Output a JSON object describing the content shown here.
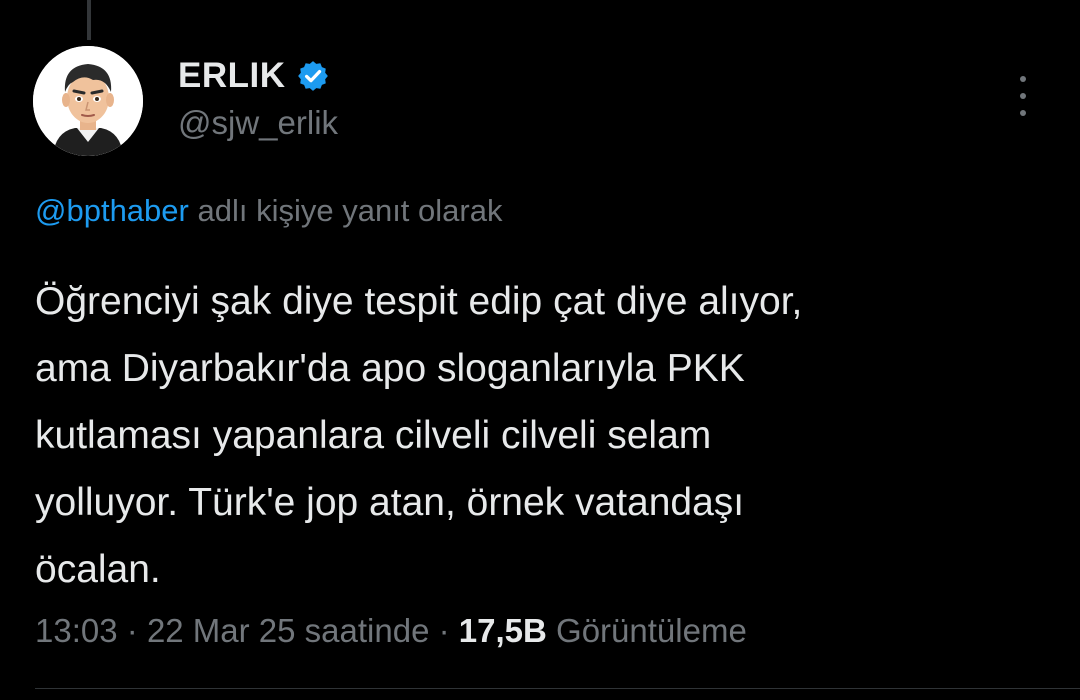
{
  "author": {
    "display_name": "ERLIK",
    "handle": "@sjw_erlik",
    "verified": true,
    "verified_color": "#1d9bf0",
    "avatar_icon": "cartoon-man-avatar"
  },
  "reply_context": {
    "mention": "@bpthaber",
    "suffix": "adlı kişiye yanıt olarak"
  },
  "tweet": {
    "lines": [
      "Öğrenciyi şak diye tespit edip çat diye alıyor,",
      "ama Diyarbakır'da apo sloganlarıyla PKK",
      "kutlaması yapanlara cilveli cilveli selam",
      "yolluyor. Türk'e jop atan, örnek vatandaşı",
      "öcalan."
    ]
  },
  "meta": {
    "time": "13:03",
    "separator": "·",
    "date": "22 Mar 25 saatinde",
    "views_count": "17,5B",
    "views_label": "Görüntüleme"
  },
  "colors": {
    "background": "#000000",
    "text_primary": "#e7e9ea",
    "text_secondary": "#71767b",
    "link": "#1d9bf0"
  }
}
